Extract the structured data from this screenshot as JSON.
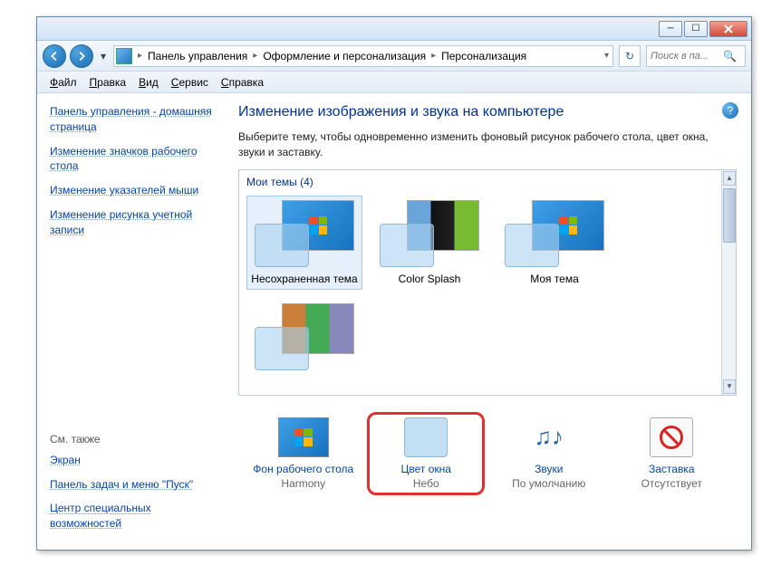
{
  "breadcrumbs": [
    "Панель управления",
    "Оформление и персонализация",
    "Персонализация"
  ],
  "search_placeholder": "Поиск в па...",
  "menus": [
    "Файл",
    "Правка",
    "Вид",
    "Сервис",
    "Справка"
  ],
  "sidebar": {
    "links": [
      "Панель управления - домашняя страница",
      "Изменение значков рабочего стола",
      "Изменение указателей мыши",
      "Изменение рисунка учетной записи"
    ],
    "see_also_label": "См. также",
    "see_also": [
      "Экран",
      "Панель задач и меню \"Пуск\"",
      "Центр специальных возможностей"
    ]
  },
  "main": {
    "title": "Изменение изображения и звука на компьютере",
    "desc": "Выберите тему, чтобы одновременно изменить фоновый рисунок рабочего стола, цвет окна, звуки и заставку.",
    "section_label": "Мои темы (4)",
    "themes": [
      {
        "name": "Несохраненная тема",
        "selected": true,
        "variant": "default"
      },
      {
        "name": "Color Splash",
        "selected": false,
        "variant": "splash"
      },
      {
        "name": "Моя тема",
        "selected": false,
        "variant": "default"
      },
      {
        "name": "",
        "selected": false,
        "variant": "multi"
      }
    ],
    "bottom": [
      {
        "key": "desktop",
        "label": "Фон рабочего стола",
        "value": "Harmony"
      },
      {
        "key": "color",
        "label": "Цвет окна",
        "value": "Небо",
        "highlight": true
      },
      {
        "key": "sounds",
        "label": "Звуки",
        "value": "По умолчанию"
      },
      {
        "key": "saver",
        "label": "Заставка",
        "value": "Отсутствует"
      }
    ]
  }
}
